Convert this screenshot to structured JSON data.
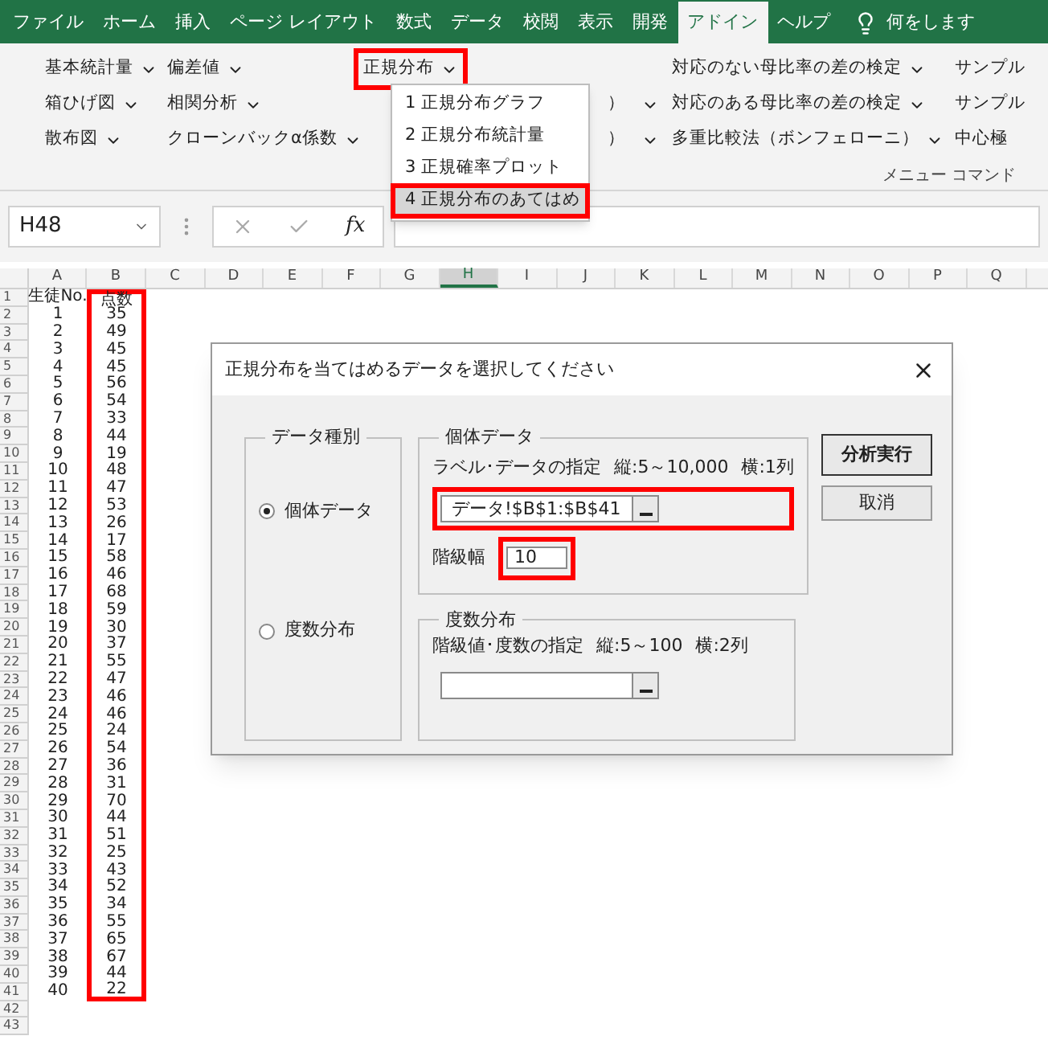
{
  "ribbon_tabs": [
    {
      "label": "ファイル",
      "selected": false
    },
    {
      "label": "ホーム",
      "selected": false
    },
    {
      "label": "挿入",
      "selected": false
    },
    {
      "label": "ページ レイアウト",
      "selected": false
    },
    {
      "label": "数式",
      "selected": false
    },
    {
      "label": "データ",
      "selected": false
    },
    {
      "label": "校閲",
      "selected": false
    },
    {
      "label": "表示",
      "selected": false
    },
    {
      "label": "開発",
      "selected": false
    },
    {
      "label": "アドイン",
      "selected": true
    },
    {
      "label": "ヘルプ",
      "selected": false
    }
  ],
  "tell_me": {
    "label": "何をします"
  },
  "ribbon_columns": [
    {
      "items": [
        {
          "kind": "menu",
          "label": "基本統計量",
          "highlighted": false
        },
        {
          "kind": "menu",
          "label": "箱ひげ図",
          "highlighted": false
        },
        {
          "kind": "menu",
          "label": "散布図",
          "highlighted": false
        }
      ]
    },
    {
      "items": [
        {
          "kind": "menu",
          "label": "偏差値",
          "highlighted": false
        },
        {
          "kind": "menu",
          "label": "相関分析",
          "highlighted": false
        },
        {
          "kind": "menu",
          "label": "クローンバックα係数",
          "highlighted": false
        }
      ]
    },
    {
      "items": [
        {
          "kind": "menu",
          "label": "正規分布",
          "highlighted": true
        },
        {
          "kind": "obscured",
          "label": "）",
          "highlighted": false
        },
        {
          "kind": "obscured",
          "label": "）",
          "highlighted": false
        }
      ]
    },
    {
      "items": [
        {
          "kind": "menu",
          "label": "対応のない母比率の差の検定",
          "highlighted": false
        },
        {
          "kind": "menu",
          "label": "対応のある母比率の差の検定",
          "highlighted": false
        },
        {
          "kind": "menu",
          "label": "多重比較法（ボンフェローニ）",
          "highlighted": false
        }
      ]
    },
    {
      "items": [
        {
          "kind": "cut",
          "label": "サンプル",
          "highlighted": false
        },
        {
          "kind": "cut",
          "label": "サンプル",
          "highlighted": false
        },
        {
          "kind": "cut",
          "label": "中心極",
          "highlighted": false
        }
      ]
    }
  ],
  "group_label": "メニュー コマンド",
  "dropdown": {
    "items": [
      {
        "label": "1 正規分布グラフ",
        "selected": false,
        "highlighted": false
      },
      {
        "label": "2 正規分布統計量",
        "selected": false,
        "highlighted": false
      },
      {
        "label": "3 正規確率プロット",
        "selected": false,
        "highlighted": false
      },
      {
        "label": "4 正規分布のあてはめ",
        "selected": true,
        "highlighted": true
      }
    ]
  },
  "name_box": {
    "value": "H48"
  },
  "formula_bar": {
    "function_label": "fx"
  },
  "sheet": {
    "columns": [
      {
        "label": "A",
        "selected": false,
        "highlighted": false
      },
      {
        "label": "B",
        "selected": false,
        "highlighted": true
      },
      {
        "label": "C",
        "selected": false,
        "highlighted": false
      },
      {
        "label": "D",
        "selected": false,
        "highlighted": false
      },
      {
        "label": "E",
        "selected": false,
        "highlighted": false
      },
      {
        "label": "F",
        "selected": false,
        "highlighted": false
      },
      {
        "label": "G",
        "selected": false,
        "highlighted": false
      },
      {
        "label": "H",
        "selected": true,
        "highlighted": false
      },
      {
        "label": "I",
        "selected": false,
        "highlighted": false
      },
      {
        "label": "J",
        "selected": false,
        "highlighted": false
      },
      {
        "label": "K",
        "selected": false,
        "highlighted": false
      },
      {
        "label": "L",
        "selected": false,
        "highlighted": false
      },
      {
        "label": "M",
        "selected": false,
        "highlighted": false
      },
      {
        "label": "N",
        "selected": false,
        "highlighted": false
      },
      {
        "label": "O",
        "selected": false,
        "highlighted": false
      },
      {
        "label": "P",
        "selected": false,
        "highlighted": false
      },
      {
        "label": "Q",
        "selected": false,
        "highlighted": false
      }
    ],
    "rows": [
      {
        "number": "1",
        "cells": [
          "生徒No.",
          "点数"
        ]
      },
      {
        "number": "2",
        "cells": [
          "1",
          "35"
        ]
      },
      {
        "number": "3",
        "cells": [
          "2",
          "49"
        ]
      },
      {
        "number": "4",
        "cells": [
          "3",
          "45"
        ]
      },
      {
        "number": "5",
        "cells": [
          "4",
          "45"
        ]
      },
      {
        "number": "6",
        "cells": [
          "5",
          "56"
        ]
      },
      {
        "number": "7",
        "cells": [
          "6",
          "54"
        ]
      },
      {
        "number": "8",
        "cells": [
          "7",
          "33"
        ]
      },
      {
        "number": "9",
        "cells": [
          "8",
          "44"
        ]
      },
      {
        "number": "10",
        "cells": [
          "9",
          "19"
        ]
      },
      {
        "number": "11",
        "cells": [
          "10",
          "48"
        ]
      },
      {
        "number": "12",
        "cells": [
          "11",
          "47"
        ]
      },
      {
        "number": "13",
        "cells": [
          "12",
          "53"
        ]
      },
      {
        "number": "14",
        "cells": [
          "13",
          "26"
        ]
      },
      {
        "number": "15",
        "cells": [
          "14",
          "17"
        ]
      },
      {
        "number": "16",
        "cells": [
          "15",
          "58"
        ]
      },
      {
        "number": "17",
        "cells": [
          "16",
          "46"
        ]
      },
      {
        "number": "18",
        "cells": [
          "17",
          "68"
        ]
      },
      {
        "number": "19",
        "cells": [
          "18",
          "59"
        ]
      },
      {
        "number": "20",
        "cells": [
          "19",
          "30"
        ]
      },
      {
        "number": "21",
        "cells": [
          "20",
          "37"
        ]
      },
      {
        "number": "22",
        "cells": [
          "21",
          "55"
        ]
      },
      {
        "number": "23",
        "cells": [
          "22",
          "47"
        ]
      },
      {
        "number": "24",
        "cells": [
          "23",
          "46"
        ]
      },
      {
        "number": "25",
        "cells": [
          "24",
          "46"
        ]
      },
      {
        "number": "26",
        "cells": [
          "25",
          "24"
        ]
      },
      {
        "number": "27",
        "cells": [
          "26",
          "54"
        ]
      },
      {
        "number": "28",
        "cells": [
          "27",
          "36"
        ]
      },
      {
        "number": "29",
        "cells": [
          "28",
          "31"
        ]
      },
      {
        "number": "30",
        "cells": [
          "29",
          "70"
        ]
      },
      {
        "number": "31",
        "cells": [
          "30",
          "44"
        ]
      },
      {
        "number": "32",
        "cells": [
          "31",
          "51"
        ]
      },
      {
        "number": "33",
        "cells": [
          "32",
          "25"
        ]
      },
      {
        "number": "34",
        "cells": [
          "33",
          "43"
        ]
      },
      {
        "number": "35",
        "cells": [
          "34",
          "52"
        ]
      },
      {
        "number": "36",
        "cells": [
          "35",
          "34"
        ]
      },
      {
        "number": "37",
        "cells": [
          "36",
          "55"
        ]
      },
      {
        "number": "38",
        "cells": [
          "37",
          "65"
        ]
      },
      {
        "number": "39",
        "cells": [
          "38",
          "67"
        ]
      },
      {
        "number": "40",
        "cells": [
          "39",
          "44"
        ]
      },
      {
        "number": "41",
        "cells": [
          "40",
          "22"
        ]
      },
      {
        "number": "42"
      },
      {
        "number": "43"
      }
    ]
  },
  "dialog": {
    "title": "正規分布を当てはめるデータを選択してください",
    "data_type_group": {
      "title": "データ種別",
      "options": [
        {
          "label": "個体データ",
          "selected": true
        },
        {
          "label": "度数分布",
          "selected": false
        }
      ]
    },
    "individual_group": {
      "title": "個体データ",
      "range_label": "ラベル･データの指定",
      "range_rows": "縦:5～10,000",
      "range_cols": "横:1列",
      "range_value": "データ!$B$1:$B$41",
      "range_highlighted": true,
      "class_width_label": "階級幅",
      "class_width_value": "10",
      "class_width_highlighted": true
    },
    "frequency_group": {
      "title": "度数分布",
      "range_label": "階級値･度数の指定",
      "range_rows": "縦:5～100",
      "range_cols": "横:2列"
    },
    "buttons": [
      {
        "label": "分析実行",
        "default": true
      },
      {
        "label": "取消",
        "default": false
      }
    ]
  }
}
